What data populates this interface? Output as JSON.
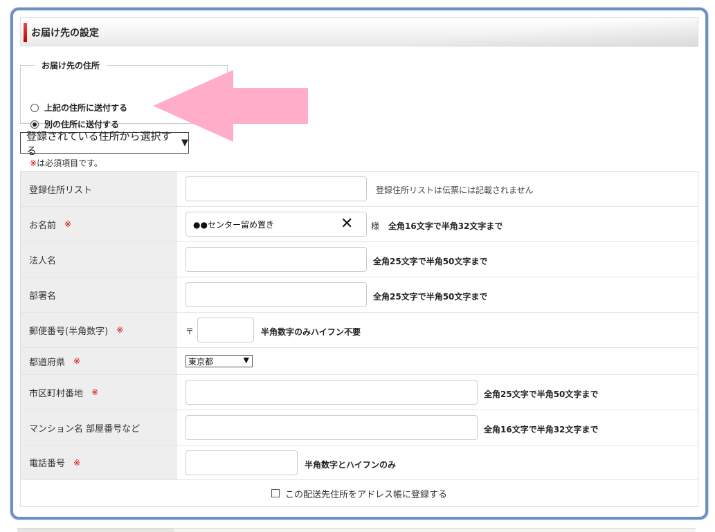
{
  "section": {
    "title": "お届け先の設定"
  },
  "address_choice": {
    "legend": "お届け先の住所",
    "options": [
      {
        "label": "上記の住所に送付する",
        "selected": false
      },
      {
        "label": "別の住所に送付する",
        "selected": true
      }
    ]
  },
  "saved_address": {
    "button_label": "登録されている住所から選択する"
  },
  "required_note": {
    "mark": "※",
    "text": "は必須項目です。"
  },
  "form": {
    "required_mark": "※",
    "rows": [
      {
        "label": "登録住所リスト",
        "required": false,
        "value": "",
        "hint": "登録住所リストは伝票には記載されません"
      },
      {
        "label": "お名前",
        "required": true,
        "value": "●●センター留め置き",
        "suffix": "様",
        "hint": "全角16文字で半角32文字まで"
      },
      {
        "label": "法人名",
        "required": false,
        "value": "",
        "hint": "全角25文字で半角50文字まで"
      },
      {
        "label": "部署名",
        "required": false,
        "value": "",
        "hint": "全角25文字で半角50文字まで"
      },
      {
        "label": "郵便番号(半角数字)",
        "required": true,
        "prefix": "〒",
        "value": "",
        "hint": "半角数字のみハイフン不要"
      },
      {
        "label": "都道府県",
        "required": true,
        "selected": "東京都"
      },
      {
        "label": "市区町村番地",
        "required": true,
        "value": "",
        "hint": "全角25文字で半角50文字まで"
      },
      {
        "label": "マンション名 部屋番号など",
        "required": false,
        "value": "",
        "hint": "全角16文字で半角32文字まで"
      },
      {
        "label": "電話番号",
        "required": true,
        "value": "",
        "hint": "半角数字とハイフンのみ"
      }
    ],
    "register_label": "この配送先住所をアドレス帳に登録する"
  },
  "colors": {
    "frame_border": "#6d8fc1",
    "accent_red": "#d40000",
    "arrow_pink": "#ffadc8",
    "label_bg": "#eeeeee"
  },
  "icons": {
    "clear": "x-icon",
    "dropdown": "chevron-down-icon"
  }
}
